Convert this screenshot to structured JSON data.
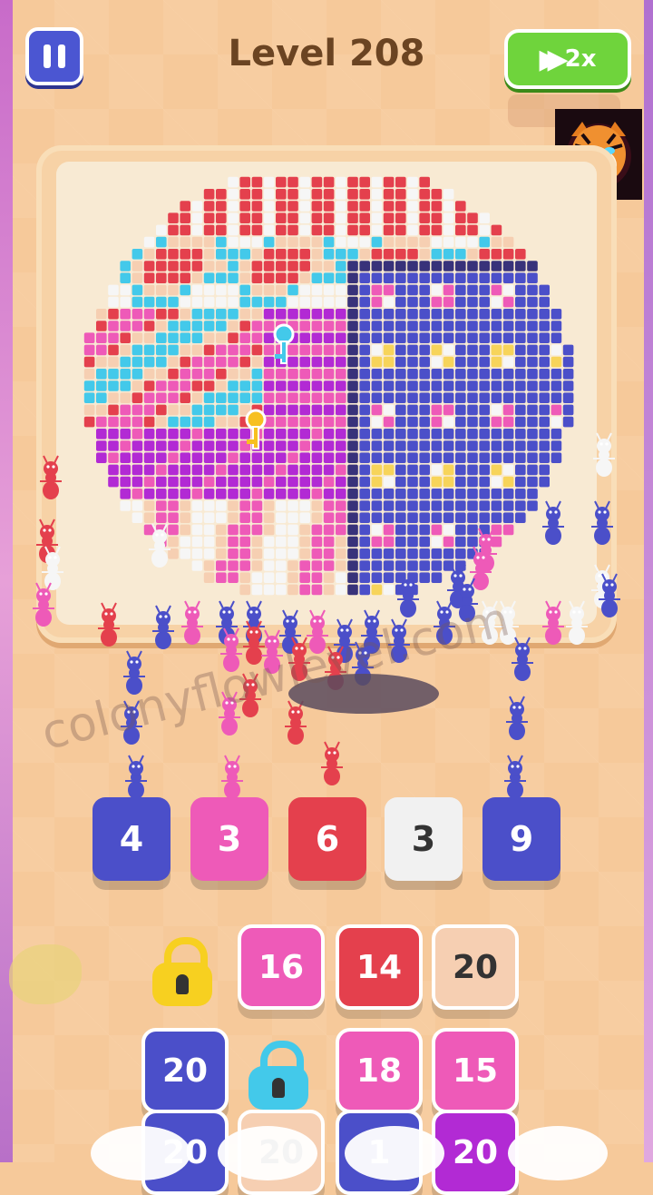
{
  "header": {
    "level_label": "Level 208",
    "speed_label": "2x",
    "pause_icon": "pause-icon",
    "speed_icon": "fast-forward-icon"
  },
  "watermark": "colonyflowlevel.com",
  "collect_slots": [
    {
      "count": "4",
      "color": "#4b4fc9"
    },
    {
      "count": "3",
      "color": "#ee5ab8"
    },
    {
      "count": "6",
      "color": "#e4404d"
    },
    {
      "count": "3",
      "color": "#f1f1f1"
    },
    {
      "count": "9",
      "color": "#4b4fc9"
    }
  ],
  "queue": {
    "row1": [
      {
        "type": "lock",
        "color": "#f7d020",
        "icon": "lock-icon"
      },
      {
        "count": "16",
        "color": "#ee5ab8"
      },
      {
        "count": "14",
        "color": "#e4404d"
      },
      {
        "count": "20",
        "color": "#f6cfb2"
      }
    ],
    "row2": [
      {
        "count": "20",
        "color": "#4b4fc9"
      },
      {
        "type": "lock",
        "color": "#43c9ea",
        "icon": "lock-icon"
      },
      {
        "count": "18",
        "color": "#ee5ab8"
      },
      {
        "count": "15",
        "color": "#ee5ab8"
      }
    ],
    "row3": [
      {
        "count": "20",
        "color": "#4b4fc9"
      },
      {
        "count": "20",
        "color": "#f6cfb2"
      },
      {
        "count": "1",
        "color": "#4b4fc9"
      },
      {
        "count": "20",
        "color": "#b22ad4"
      }
    ]
  },
  "colors": {
    "navy": "#4b4fc9",
    "pink": "#ee5ab8",
    "red": "#e4404d",
    "peach": "#f6cfb2",
    "cyan": "#43c9ea",
    "magenta": "#b22ad4",
    "white": "#f6f6f6",
    "yellow": "#f7d45a"
  }
}
